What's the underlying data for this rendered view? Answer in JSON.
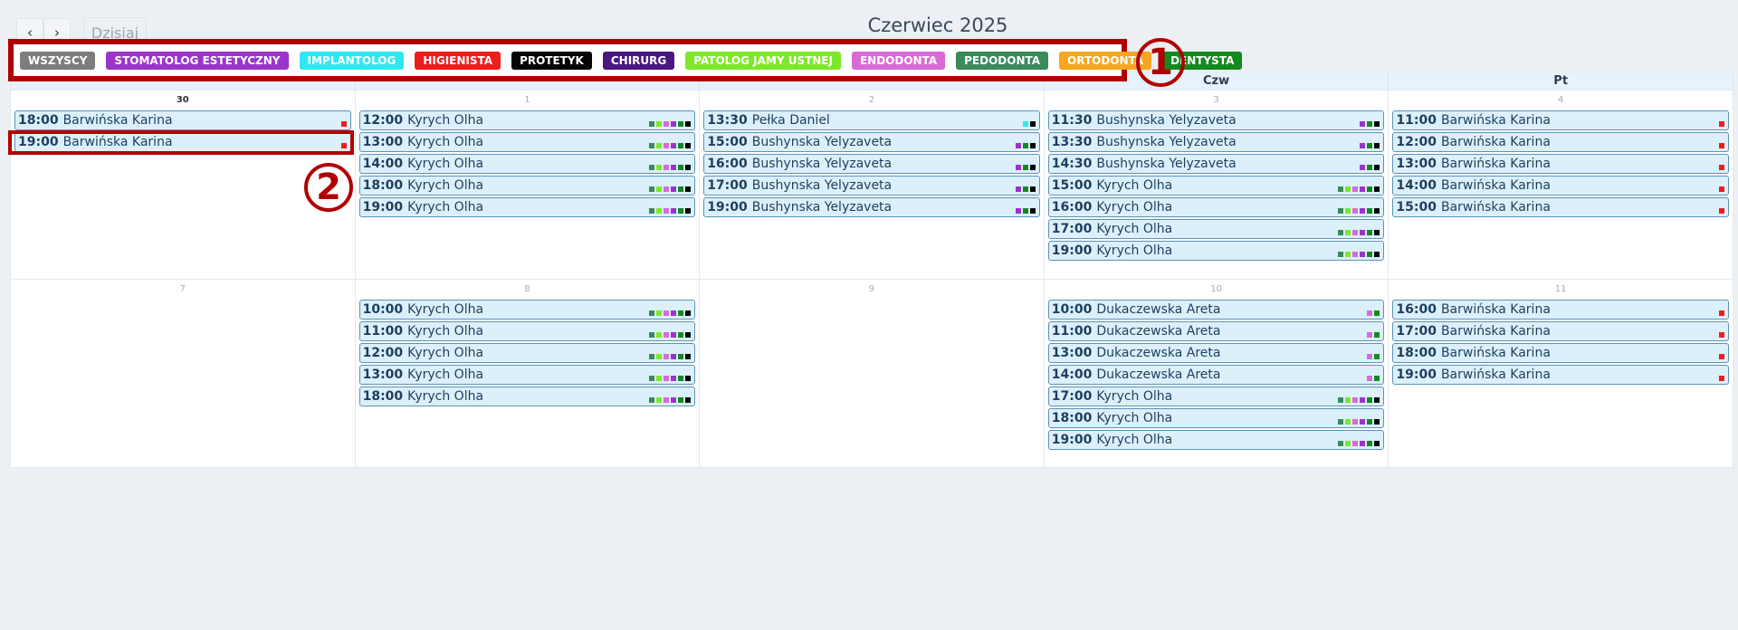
{
  "toolbar": {
    "prev_label": "‹",
    "next_label": "›",
    "today_label": "Dzisiaj",
    "title": "Czerwiec 2025"
  },
  "filters": [
    {
      "label": "WSZYSCY",
      "color": "#7d7d7d"
    },
    {
      "label": "STOMATOLOG ESTETYCZNY",
      "color": "#9b35c9"
    },
    {
      "label": "IMPLANTOLOG",
      "color": "#2ee8f0"
    },
    {
      "label": "HIGIENISTA",
      "color": "#ee1c1c"
    },
    {
      "label": "PROTETYK",
      "color": "#050505"
    },
    {
      "label": "CHIRURG",
      "color": "#4b1780"
    },
    {
      "label": "PATOLOG JAMY USTNEJ",
      "color": "#7de82a"
    },
    {
      "label": "ENDODONTA",
      "color": "#d96bd6"
    },
    {
      "label": "PEDODONTA",
      "color": "#3a8a5a"
    },
    {
      "label": "ORTODONTA",
      "color": "#f5a623"
    },
    {
      "label": "DENTYSTA",
      "color": "#138a1e"
    }
  ],
  "columns": [
    "",
    "",
    "",
    "Czw",
    "Pt"
  ],
  "annotations": {
    "one": "①",
    "two": "②"
  },
  "weeks": [
    {
      "days": [
        {
          "number": "30",
          "bold": true,
          "events": [
            {
              "time": "18:00",
              "name": "Barwińska Karina",
              "marks": [
                "#ee1c1c"
              ]
            },
            {
              "time": "19:00",
              "name": "Barwińska Karina",
              "marks": [
                "#ee1c1c"
              ]
            }
          ]
        },
        {
          "number": "1",
          "bold": false,
          "events": [
            {
              "time": "12:00",
              "name": "Kyrych Olha",
              "marks": [
                "#3a8a5a",
                "#7de82a",
                "#d96bd6",
                "#9b35c9",
                "#138a1e",
                "#050505"
              ]
            },
            {
              "time": "13:00",
              "name": "Kyrych Olha",
              "marks": [
                "#3a8a5a",
                "#7de82a",
                "#d96bd6",
                "#9b35c9",
                "#138a1e",
                "#050505"
              ]
            },
            {
              "time": "14:00",
              "name": "Kyrych Olha",
              "marks": [
                "#3a8a5a",
                "#7de82a",
                "#d96bd6",
                "#9b35c9",
                "#138a1e",
                "#050505"
              ]
            },
            {
              "time": "18:00",
              "name": "Kyrych Olha",
              "marks": [
                "#3a8a5a",
                "#7de82a",
                "#d96bd6",
                "#9b35c9",
                "#138a1e",
                "#050505"
              ]
            },
            {
              "time": "19:00",
              "name": "Kyrych Olha",
              "marks": [
                "#3a8a5a",
                "#7de82a",
                "#d96bd6",
                "#9b35c9",
                "#138a1e",
                "#050505"
              ]
            }
          ]
        },
        {
          "number": "2",
          "bold": false,
          "events": [
            {
              "time": "13:30",
              "name": "Pełka Daniel",
              "marks": [
                "#2ee8f0",
                "#050505"
              ]
            },
            {
              "time": "15:00",
              "name": "Bushynska Yelyzaveta",
              "marks": [
                "#9b35c9",
                "#138a1e",
                "#050505"
              ]
            },
            {
              "time": "16:00",
              "name": "Bushynska Yelyzaveta",
              "marks": [
                "#9b35c9",
                "#138a1e",
                "#050505"
              ]
            },
            {
              "time": "17:00",
              "name": "Bushynska Yelyzaveta",
              "marks": [
                "#9b35c9",
                "#138a1e",
                "#050505"
              ]
            },
            {
              "time": "19:00",
              "name": "Bushynska Yelyzaveta",
              "marks": [
                "#9b35c9",
                "#138a1e",
                "#050505"
              ]
            }
          ]
        },
        {
          "number": "3",
          "bold": false,
          "events": [
            {
              "time": "11:30",
              "name": "Bushynska Yelyzaveta",
              "marks": [
                "#9b35c9",
                "#138a1e",
                "#050505"
              ]
            },
            {
              "time": "13:30",
              "name": "Bushynska Yelyzaveta",
              "marks": [
                "#9b35c9",
                "#138a1e",
                "#050505"
              ]
            },
            {
              "time": "14:30",
              "name": "Bushynska Yelyzaveta",
              "marks": [
                "#9b35c9",
                "#138a1e",
                "#050505"
              ]
            },
            {
              "time": "15:00",
              "name": "Kyrych Olha",
              "marks": [
                "#3a8a5a",
                "#7de82a",
                "#d96bd6",
                "#9b35c9",
                "#138a1e",
                "#050505"
              ]
            },
            {
              "time": "16:00",
              "name": "Kyrych Olha",
              "marks": [
                "#3a8a5a",
                "#7de82a",
                "#d96bd6",
                "#9b35c9",
                "#138a1e",
                "#050505"
              ]
            },
            {
              "time": "17:00",
              "name": "Kyrych Olha",
              "marks": [
                "#3a8a5a",
                "#7de82a",
                "#d96bd6",
                "#9b35c9",
                "#138a1e",
                "#050505"
              ]
            },
            {
              "time": "19:00",
              "name": "Kyrych Olha",
              "marks": [
                "#3a8a5a",
                "#7de82a",
                "#d96bd6",
                "#9b35c9",
                "#138a1e",
                "#050505"
              ]
            }
          ]
        },
        {
          "number": "4",
          "bold": false,
          "events": [
            {
              "time": "11:00",
              "name": "Barwińska Karina",
              "marks": [
                "#ee1c1c"
              ]
            },
            {
              "time": "12:00",
              "name": "Barwińska Karina",
              "marks": [
                "#ee1c1c"
              ]
            },
            {
              "time": "13:00",
              "name": "Barwińska Karina",
              "marks": [
                "#ee1c1c"
              ]
            },
            {
              "time": "14:00",
              "name": "Barwińska Karina",
              "marks": [
                "#ee1c1c"
              ]
            },
            {
              "time": "15:00",
              "name": "Barwińska Karina",
              "marks": [
                "#ee1c1c"
              ]
            }
          ]
        }
      ]
    },
    {
      "days": [
        {
          "number": "7",
          "bold": false,
          "events": []
        },
        {
          "number": "8",
          "bold": false,
          "events": [
            {
              "time": "10:00",
              "name": "Kyrych Olha",
              "marks": [
                "#3a8a5a",
                "#7de82a",
                "#d96bd6",
                "#9b35c9",
                "#138a1e",
                "#050505"
              ]
            },
            {
              "time": "11:00",
              "name": "Kyrych Olha",
              "marks": [
                "#3a8a5a",
                "#7de82a",
                "#d96bd6",
                "#9b35c9",
                "#138a1e",
                "#050505"
              ]
            },
            {
              "time": "12:00",
              "name": "Kyrych Olha",
              "marks": [
                "#3a8a5a",
                "#7de82a",
                "#d96bd6",
                "#9b35c9",
                "#138a1e",
                "#050505"
              ]
            },
            {
              "time": "13:00",
              "name": "Kyrych Olha",
              "marks": [
                "#3a8a5a",
                "#7de82a",
                "#d96bd6",
                "#9b35c9",
                "#138a1e",
                "#050505"
              ]
            },
            {
              "time": "18:00",
              "name": "Kyrych Olha",
              "marks": [
                "#3a8a5a",
                "#7de82a",
                "#d96bd6",
                "#9b35c9",
                "#138a1e",
                "#050505"
              ]
            }
          ]
        },
        {
          "number": "9",
          "bold": false,
          "events": []
        },
        {
          "number": "10",
          "bold": false,
          "events": [
            {
              "time": "10:00",
              "name": "Dukaczewska Areta",
              "marks": [
                "#d96bd6",
                "#138a1e"
              ]
            },
            {
              "time": "11:00",
              "name": "Dukaczewska Areta",
              "marks": [
                "#d96bd6",
                "#138a1e"
              ]
            },
            {
              "time": "13:00",
              "name": "Dukaczewska Areta",
              "marks": [
                "#d96bd6",
                "#138a1e"
              ]
            },
            {
              "time": "14:00",
              "name": "Dukaczewska Areta",
              "marks": [
                "#d96bd6",
                "#138a1e"
              ]
            },
            {
              "time": "17:00",
              "name": "Kyrych Olha",
              "marks": [
                "#3a8a5a",
                "#7de82a",
                "#d96bd6",
                "#9b35c9",
                "#138a1e",
                "#050505"
              ]
            },
            {
              "time": "18:00",
              "name": "Kyrych Olha",
              "marks": [
                "#3a8a5a",
                "#7de82a",
                "#d96bd6",
                "#9b35c9",
                "#138a1e",
                "#050505"
              ]
            },
            {
              "time": "19:00",
              "name": "Kyrych Olha",
              "marks": [
                "#3a8a5a",
                "#7de82a",
                "#d96bd6",
                "#9b35c9",
                "#138a1e",
                "#050505"
              ]
            }
          ]
        },
        {
          "number": "11",
          "bold": false,
          "events": [
            {
              "time": "16:00",
              "name": "Barwińska Karina",
              "marks": [
                "#ee1c1c"
              ]
            },
            {
              "time": "17:00",
              "name": "Barwińska Karina",
              "marks": [
                "#ee1c1c"
              ]
            },
            {
              "time": "18:00",
              "name": "Barwińska Karina",
              "marks": [
                "#ee1c1c"
              ]
            },
            {
              "time": "19:00",
              "name": "Barwińska Karina",
              "marks": [
                "#ee1c1c"
              ]
            }
          ]
        }
      ]
    }
  ]
}
